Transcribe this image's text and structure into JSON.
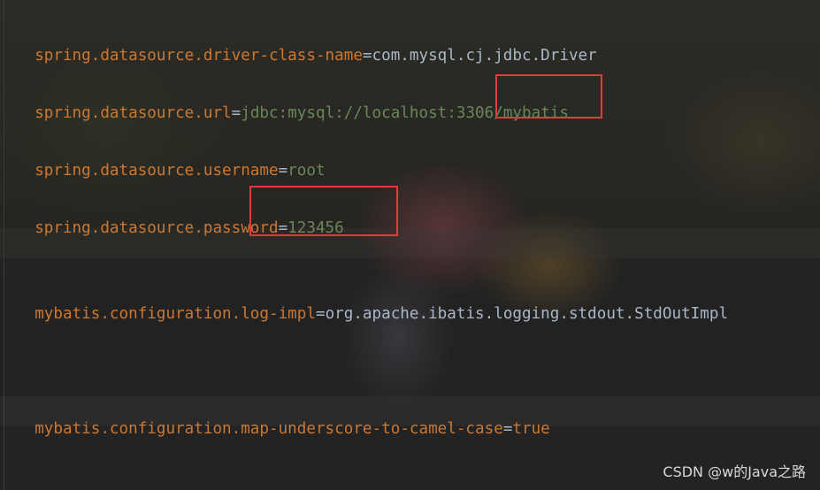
{
  "editor": {
    "lines": [
      {
        "key": "spring.datasource.driver-class-name",
        "equals": "=",
        "value": "com.mysql.cj.jdbc.Driver"
      },
      {
        "key": "spring.datasource.url",
        "equals": "=",
        "value_prefix": "jdbc:mysql://localhost:3306/",
        "value_highlight": "mybatis"
      },
      {
        "key": "spring.datasource.username",
        "equals": "=",
        "value": "root"
      },
      {
        "key": "spring.datasource.password",
        "equals": "=",
        "value": "123456"
      },
      {
        "key": "mybatis.configuration.log-impl",
        "equals": "=",
        "value": "org.apache.ibatis.logging.stdout.StdOutImpl"
      },
      {
        "key": "mybatis.configuration.map-underscore-to-camel-case",
        "equals": "=",
        "value": "true"
      }
    ]
  },
  "watermark": "CSDN @w的Java之路",
  "colors": {
    "key": "#cc7832",
    "equals": "#a9b7c6",
    "string_value": "#6a8759",
    "plain_value": "#a9b7c6",
    "highlight_border": "#e23b3b",
    "background": "#2a2a2a"
  }
}
